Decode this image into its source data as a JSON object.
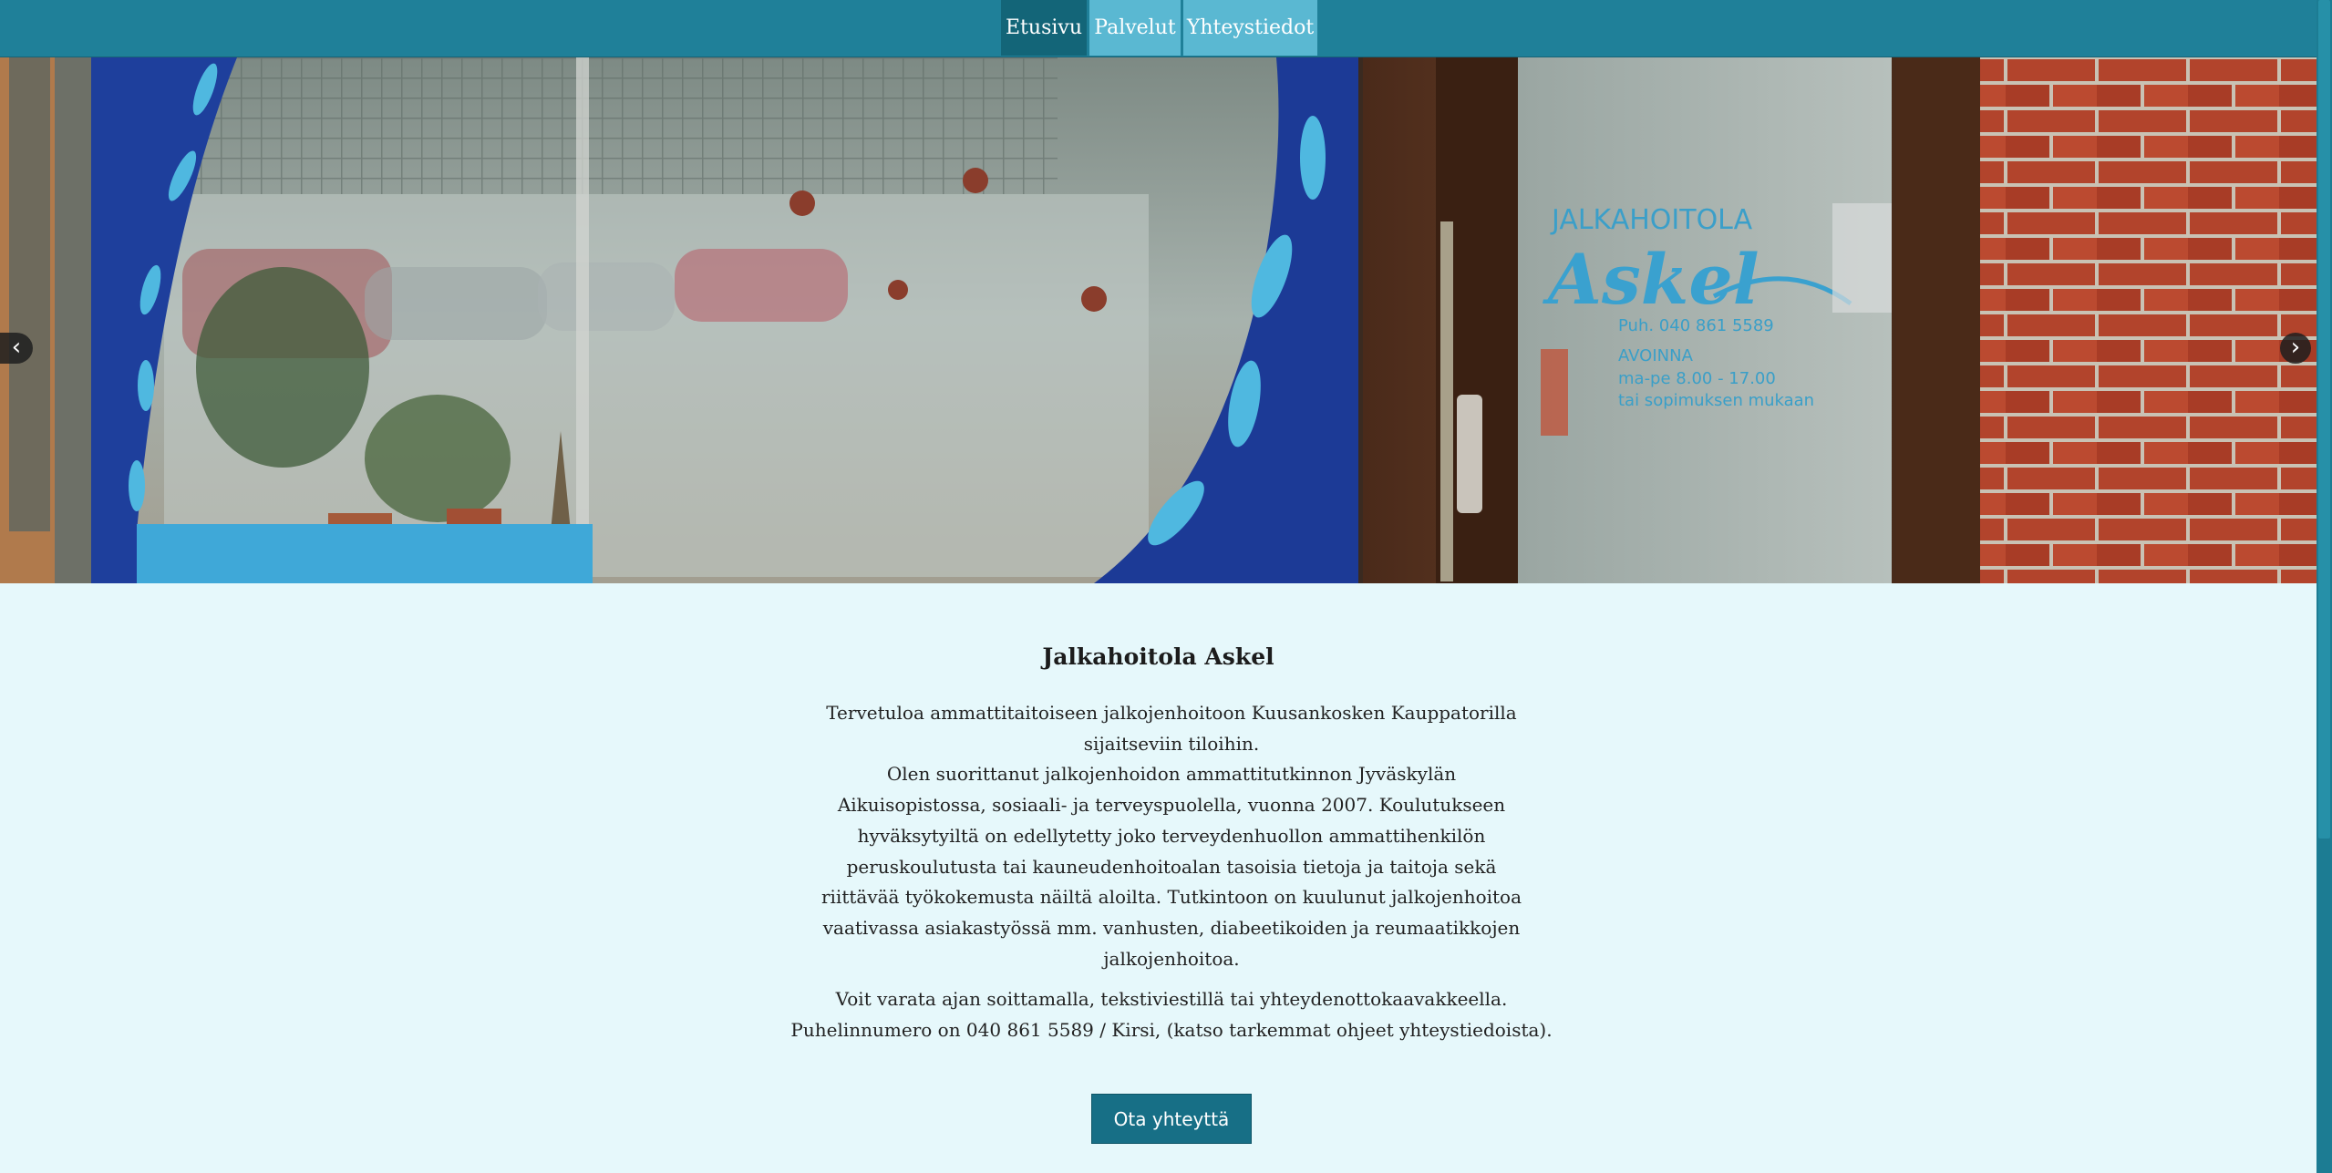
{
  "nav": {
    "items": [
      {
        "label": "Etusivu"
      },
      {
        "label": "Palvelut"
      },
      {
        "label": "Yhteystiedot"
      }
    ]
  },
  "hero": {
    "sign_line1": "JALKAHOITOLA",
    "sign_logo": "Askel",
    "sign_phone": "Puh. 040 861 5589",
    "sign_open": "AVOINNA",
    "sign_hours": "ma-pe 8.00 - 17.00",
    "sign_note": "tai sopimuksen mukaan",
    "prev_icon": "‹",
    "next_icon": "›",
    "slide_count": 4,
    "active_slide": 1
  },
  "main": {
    "title": "Jalkahoitola Askel",
    "intro_p1": "Tervetuloa ammattitaitoiseen jalkojenhoitoon Kuusankosken Kauppatorilla sijaitseviin tiloihin.",
    "intro_p2": "Olen suorittanut jalkojenhoidon ammattitutkinnon Jyväskylän Aikuisopistossa, sosiaali- ja terveyspuolella, vuonna 2007. Koulutukseen hyväksytyiltä on edellytetty joko terveydenhuollon ammattihenkilön peruskoulutusta tai kauneudenhoitoalan tasoisia tietoja ja taitoja sekä riittävää työkokemusta näiltä aloilta. Tutkintoon on kuulunut jalkojenhoitoa vaativassa asiakastyössä mm. vanhusten, diabeetikoiden ja reumaatikkojen jalkojenhoitoa.",
    "contact_p1": "Voit varata ajan soittamalla, tekstiviestillä tai yhteydenottokaavakkeella.",
    "contact_p2": "Puhelinnumero on 040 861 5589 / Kirsi, (katso tarkemmat ohjeet yhteystiedoista).",
    "cta_label": "Ota yhteyttä"
  },
  "colors": {
    "nav_bg": "#1f8099",
    "nav_active": "#136578",
    "nav_light": "#5ab8d2",
    "page_bg": "#e6f8fb",
    "button_bg": "#176f86"
  }
}
